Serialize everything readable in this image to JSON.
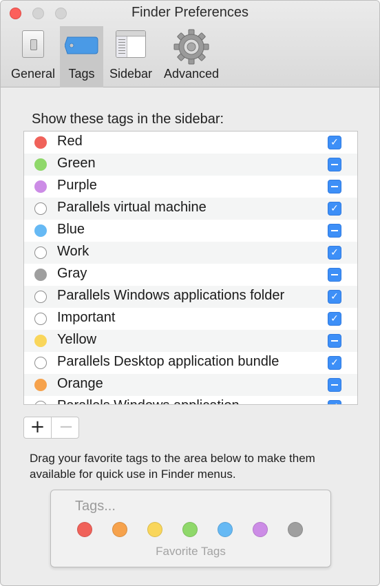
{
  "window": {
    "title": "Finder Preferences"
  },
  "toolbar": {
    "tabs": [
      {
        "label": "General",
        "icon": "light-switch-icon",
        "selected": false
      },
      {
        "label": "Tags",
        "icon": "tag-icon",
        "selected": true
      },
      {
        "label": "Sidebar",
        "icon": "sidebar-window-icon",
        "selected": false
      },
      {
        "label": "Advanced",
        "icon": "gear-icon",
        "selected": false
      }
    ]
  },
  "tags_section": {
    "title": "Show these tags in the sidebar:",
    "tags": [
      {
        "name": "Red",
        "color": "#f0625a",
        "state": "checked"
      },
      {
        "name": "Green",
        "color": "#8fd86a",
        "state": "mixed"
      },
      {
        "name": "Purple",
        "color": "#cc8ce6",
        "state": "mixed"
      },
      {
        "name": "Parallels virtual machine",
        "color": "none",
        "state": "checked"
      },
      {
        "name": "Blue",
        "color": "#66b9f4",
        "state": "mixed"
      },
      {
        "name": "Work",
        "color": "none",
        "state": "checked"
      },
      {
        "name": "Gray",
        "color": "#9f9f9f",
        "state": "mixed"
      },
      {
        "name": "Parallels Windows applications folder",
        "color": "none",
        "state": "checked"
      },
      {
        "name": "Important",
        "color": "none",
        "state": "checked"
      },
      {
        "name": "Yellow",
        "color": "#f9d65b",
        "state": "mixed"
      },
      {
        "name": "Parallels Desktop application bundle",
        "color": "none",
        "state": "checked"
      },
      {
        "name": "Orange",
        "color": "#f6a24c",
        "state": "mixed"
      },
      {
        "name": "Parallels Windows application",
        "color": "none",
        "state": "checked"
      }
    ],
    "add_label": "+",
    "remove_label": "−"
  },
  "favorites": {
    "description": "Drag your favorite tags to the area below to make them available for quick use in Finder menus.",
    "placeholder": "Tags...",
    "caption": "Favorite Tags",
    "colors": [
      "#f0625a",
      "#f6a24c",
      "#f9d65b",
      "#8fd86a",
      "#66b9f4",
      "#cc8ce6",
      "#9f9f9f"
    ]
  }
}
